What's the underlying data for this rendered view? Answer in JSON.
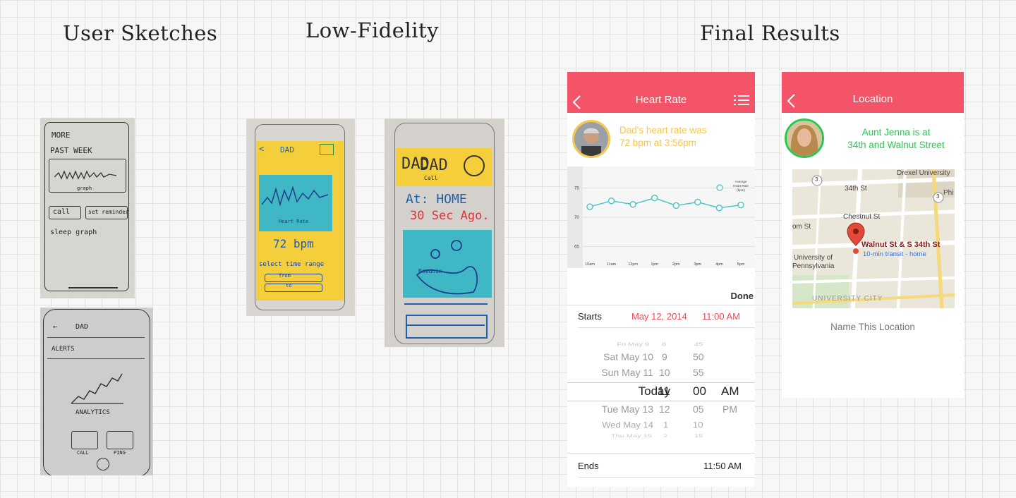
{
  "headings": {
    "sketches": "User Sketches",
    "lowfi": "Low-Fidelity",
    "final": "Final Results"
  },
  "sketch1": {
    "lines": [
      "MORE",
      "PAST WEEK",
      "graph",
      "call",
      "set reminder",
      "sleep graph"
    ]
  },
  "sketch2": {
    "title": "DAD",
    "alerts": "ALERTS",
    "analytics": "ANALYTICS",
    "call": "CALL",
    "ping": "PING"
  },
  "lowfi1": {
    "title": "DAD",
    "chart_caption": "Heart Rate",
    "bpm": "72 bpm",
    "range": "select time range",
    "field1": "from",
    "field2": "to"
  },
  "lowfi2": {
    "title": "DAD",
    "subtitle": "Call",
    "at": "At: HOME",
    "ago": "30 Sec Ago.",
    "map_label": "Bowdoin"
  },
  "heart": {
    "title": "Heart Rate",
    "status_line1": "Dad's heart rate was",
    "status_line2": "72 bpm at 3:56pm",
    "legend": [
      "Average",
      "Heart Rate",
      "(bpm)"
    ],
    "chart_data": {
      "type": "line",
      "categories": [
        "10am",
        "11am",
        "12pm",
        "1pm",
        "2pm",
        "3pm",
        "4pm",
        "5pm"
      ],
      "values": [
        71.8,
        72.8,
        72.2,
        73.3,
        72,
        72.6,
        71.6,
        72.1
      ],
      "yticks": [
        "75",
        "70",
        "65"
      ],
      "ylim": [
        63,
        77
      ]
    },
    "done": "Done",
    "starts_label": "Starts",
    "starts_date": "May 12, 2014",
    "starts_time": "11:00 AM",
    "picker_rows": [
      {
        "day": "Fri May 9",
        "hour": "8",
        "min": "45",
        "ampm": ""
      },
      {
        "day": "Sat May 10",
        "hour": "9",
        "min": "50",
        "ampm": ""
      },
      {
        "day": "Sun May 11",
        "hour": "10",
        "min": "55",
        "ampm": ""
      },
      {
        "day": "Today",
        "hour": "11",
        "min": "00",
        "ampm": "AM"
      },
      {
        "day": "Tue May 13",
        "hour": "12",
        "min": "05",
        "ampm": "PM"
      },
      {
        "day": "Wed May 14",
        "hour": "1",
        "min": "10",
        "ampm": ""
      },
      {
        "day": "Thu May 15",
        "hour": "2",
        "min": "15",
        "ampm": ""
      }
    ],
    "ends_label": "Ends",
    "ends_time": "11:50 AM",
    "accent": "#f45467",
    "status_color": "#f7c64a",
    "line_color": "#4fc4c8"
  },
  "location": {
    "title": "Location",
    "status_line1": "Aunt Jenna is at",
    "status_line2": "34th and Walnut Street",
    "map": {
      "drexel": "Drexel University",
      "st34": "34th St",
      "phi": "Phi",
      "chestnut": "Chestnut St",
      "om_st": "om St",
      "walnut": "Walnut St & S 34th St",
      "transit": "10-min transit - home",
      "upenn1": "University of",
      "upenn2": "Pennsylvania",
      "ucity": "UNIVERSITY CITY",
      "route3a": "3",
      "route3b": "3"
    },
    "name_location": "Name This Location",
    "status_color": "#26c94f"
  }
}
